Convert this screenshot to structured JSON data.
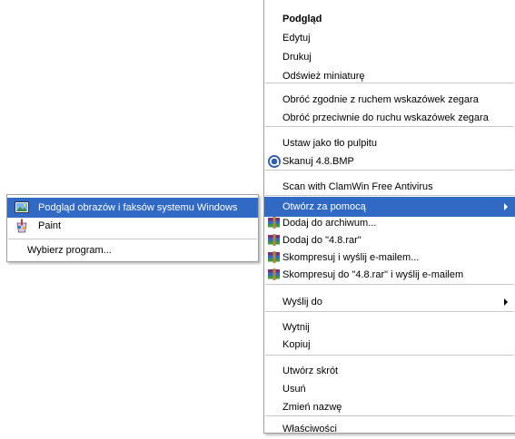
{
  "main_menu": {
    "items": [
      {
        "label": "Podgląd"
      },
      {
        "label": "Edytuj"
      },
      {
        "label": "Drukuj"
      },
      {
        "label": "Odśwież miniaturę"
      },
      {
        "label": "Obróć zgodnie z ruchem wskazówek zegara"
      },
      {
        "label": "Obróć przeciwnie do ruchu wskazówek zegara"
      },
      {
        "label": "Ustaw jako tło pulpitu"
      },
      {
        "label": "Skanuj 4.8.BMP"
      },
      {
        "label": "Scan with ClamWin Free Antivirus"
      },
      {
        "label": "Otwórz za pomocą"
      },
      {
        "label": "Dodaj do archiwum..."
      },
      {
        "label": "Dodaj do \"4.8.rar\""
      },
      {
        "label": "Skompresuj i wyślij e-mailem..."
      },
      {
        "label": "Skompresuj do \"4.8.rar\" i wyślij e-mailem"
      },
      {
        "label": "Wyślij do"
      },
      {
        "label": "Wytnij"
      },
      {
        "label": "Kopiuj"
      },
      {
        "label": "Utwórz skrót"
      },
      {
        "label": "Usuń"
      },
      {
        "label": "Zmień nazwę"
      },
      {
        "label": "Właściwości"
      }
    ],
    "highlight_color": "#316ac5"
  },
  "sub_menu": {
    "items": [
      {
        "label": "Podgląd obrazów i faksów systemu Windows",
        "icon": "image-viewer-icon"
      },
      {
        "label": "Paint",
        "icon": "paint-icon"
      },
      {
        "label": "Wybierz program..."
      }
    ]
  }
}
